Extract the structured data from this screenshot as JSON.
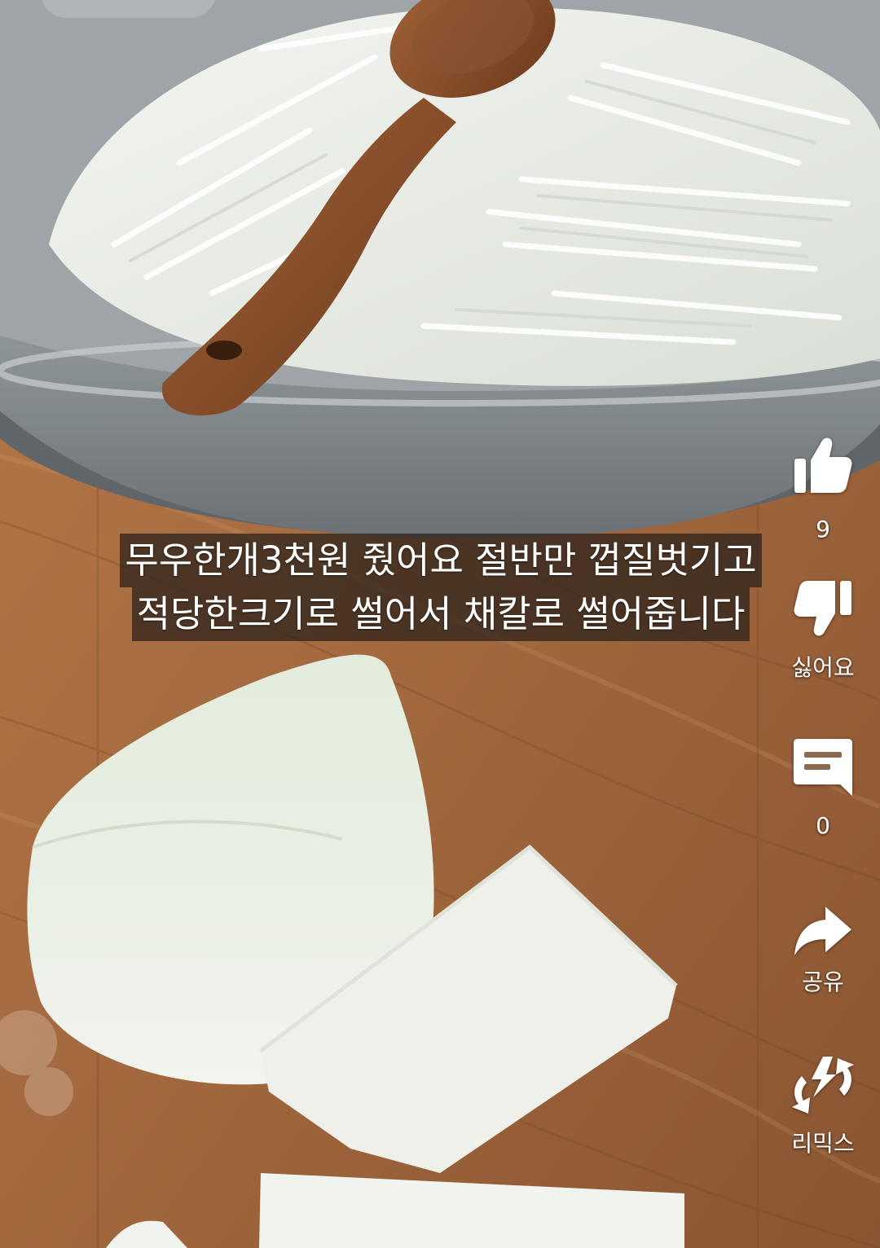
{
  "video": {
    "caption_lines": [
      "무우한개3천원 줬어요 절반만 껍질벗기고",
      "적당한크기로 썰어서 채칼로 썰어줍니다"
    ]
  },
  "actions": {
    "like": {
      "icon": "thumbs-up-icon",
      "count": "9"
    },
    "dislike": {
      "icon": "thumbs-down-icon",
      "label": "싫어요"
    },
    "comment": {
      "icon": "comment-icon",
      "count": "0"
    },
    "share": {
      "icon": "share-arrow-icon",
      "label": "공유"
    },
    "remix": {
      "icon": "remix-icon",
      "label": "리믹스"
    }
  },
  "colors": {
    "overlay_text": "#ffffff",
    "caption_bg": "#28201a",
    "board_wood": "#a46a3e",
    "bowl_steel": "#8f969a",
    "radish": "#eef2ea"
  }
}
